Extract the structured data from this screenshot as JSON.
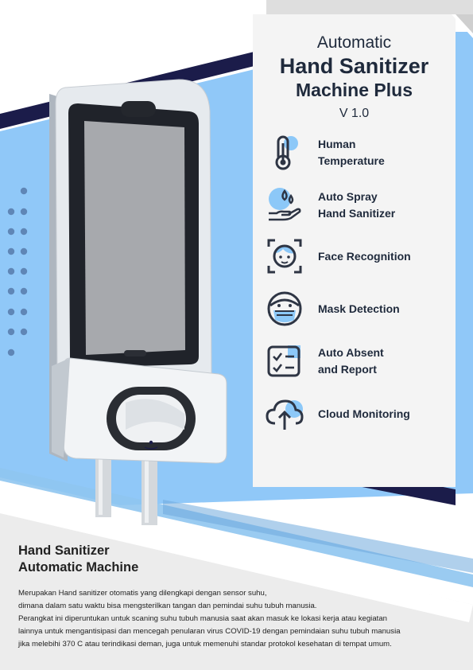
{
  "header": {
    "line1": "Automatic",
    "line2": "Hand Sanitizer",
    "line3": "Machine Plus",
    "version": "V 1.0"
  },
  "features": [
    {
      "icon": "thermometer-icon",
      "line1": "Human",
      "line2": "Temperature"
    },
    {
      "icon": "spray-hand-icon",
      "line1": "Auto Spray",
      "line2": "Hand Sanitizer"
    },
    {
      "icon": "face-scan-icon",
      "line1": "Face Recognition",
      "line2": ""
    },
    {
      "icon": "mask-face-icon",
      "line1": "Mask Detection",
      "line2": ""
    },
    {
      "icon": "checklist-icon",
      "line1": "Auto Absent",
      "line2": "and Report"
    },
    {
      "icon": "cloud-upload-icon",
      "line1": "Cloud Monitoring",
      "line2": ""
    }
  ],
  "bottom": {
    "title_line1": "Hand Sanitizer",
    "title_line2": "Automatic Machine",
    "desc_lines": [
      "Merupakan Hand sanitizer otomatis yang dilengkapi dengan sensor suhu,",
      "dimana dalam satu waktu bisa mengsterilkan tangan dan pemindai suhu tubuh manusia.",
      "Perangkat ini diperuntukan untuk scaning suhu tubuh manusia saat akan masuk ke lokasi kerja atau kegiatan",
      "lainnya untuk mengantisipasi dan mencegah penularan virus COVID-19 dengan pemindaian suhu tubuh manusia",
      "jika melebihi 370 C atau terindikasi deman, juga untuk memenuhi standar protokol kesehatan di tempat umum."
    ]
  },
  "colors": {
    "light_blue": "#90c8f8",
    "navy": "#1b1c4a",
    "panel": "#f4f4f4",
    "dark_text": "#1f2a3c",
    "icon_accent": "#8cc8f8",
    "bottom_bg": "#ececec"
  }
}
